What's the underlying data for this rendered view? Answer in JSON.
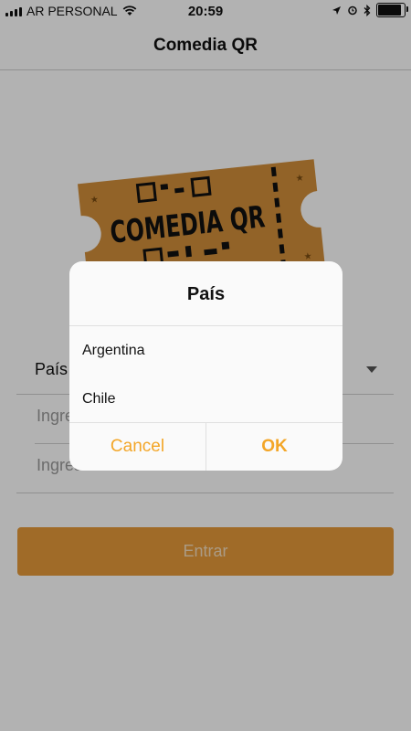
{
  "status_bar": {
    "carrier": "AR PERSONAL",
    "time": "20:59",
    "battery_level": 0.9
  },
  "nav": {
    "title": "Comedia QR"
  },
  "logo_text": "COMEDIA QR",
  "form": {
    "country_label": "País",
    "user_placeholder": "Ingresa tu usuario",
    "password_placeholder": "Ingresa tu contraseña",
    "submit_label": "Entrar"
  },
  "dialog": {
    "title": "País",
    "options": [
      "Argentina",
      "Chile"
    ],
    "cancel_label": "Cancel",
    "ok_label": "OK"
  },
  "colors": {
    "accent": "#f3a628",
    "primary_button": "#e69a3a",
    "ticket": "#d28e3a"
  }
}
